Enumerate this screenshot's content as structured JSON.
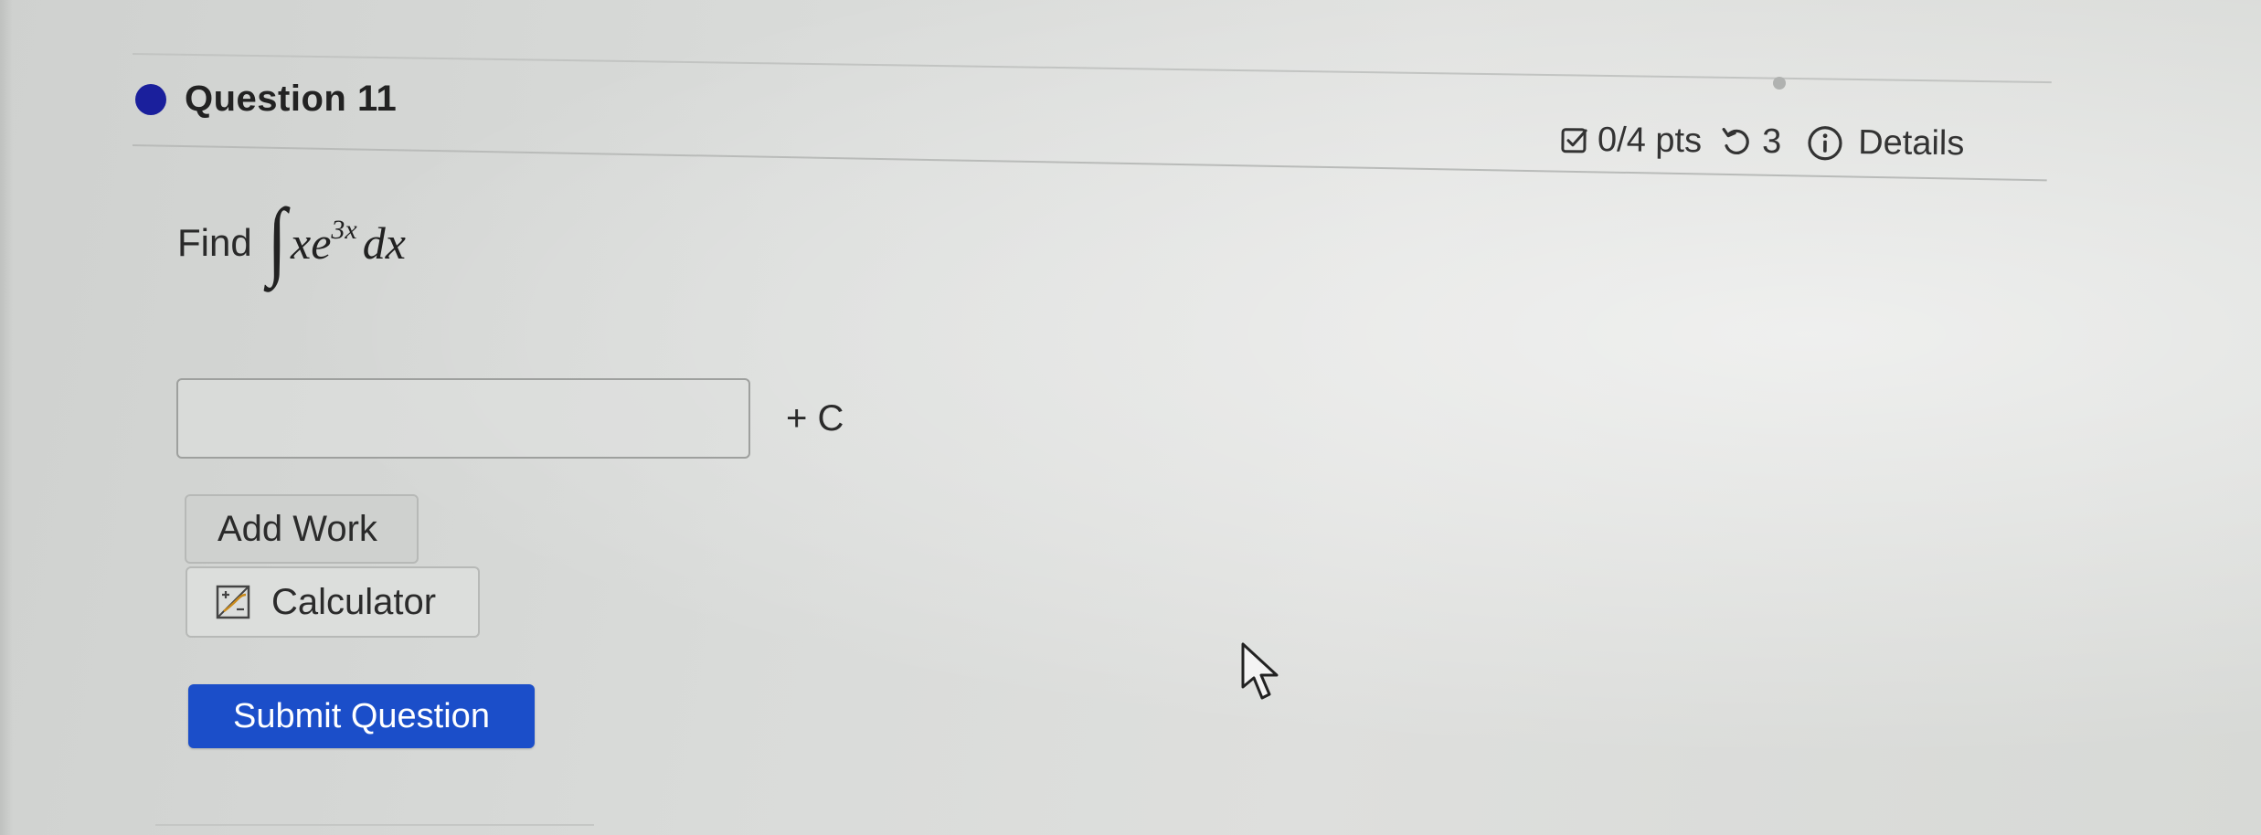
{
  "question": {
    "title": "Question 11",
    "dot_color": "#1a1f9c"
  },
  "meta": {
    "points": "0/4 pts",
    "attempts": "3",
    "details_label": "Details",
    "icons": [
      "checkbox-icon",
      "retry-icon",
      "info-icon"
    ]
  },
  "prompt": {
    "word": "Find",
    "integral_sign": "∫",
    "integrand_x": "x",
    "integrand_e": "e",
    "exponent": "3x",
    "differential": "dx"
  },
  "answer": {
    "value": "",
    "placeholder": "",
    "suffix": "+ C"
  },
  "buttons": {
    "add_work": "Add Work",
    "calculator": "Calculator",
    "submit": "Submit Question"
  },
  "colors": {
    "accent": "#1b4ec9",
    "background": "#d9dbd9"
  }
}
